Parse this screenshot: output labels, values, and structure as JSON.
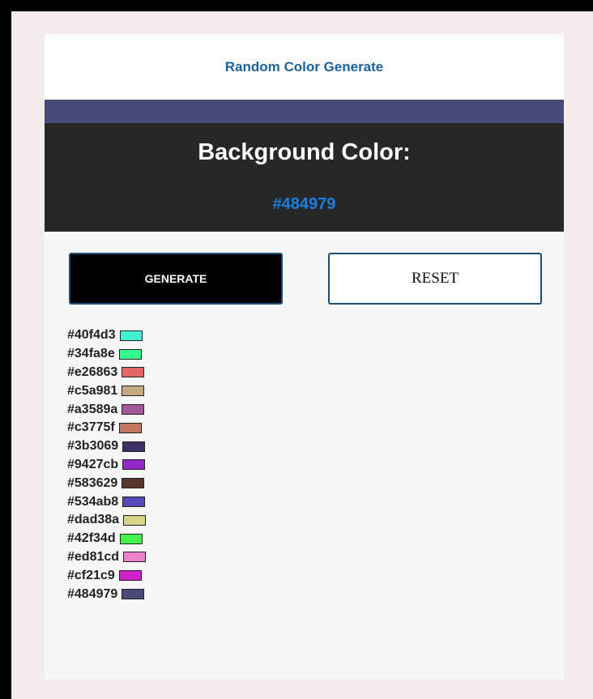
{
  "header": {
    "title": "Random Color Generate"
  },
  "display": {
    "label": "Background Color:",
    "current_color": "#484979"
  },
  "buttons": {
    "generate_label": "GENERATE",
    "reset_label": "RESET"
  },
  "history": [
    "#40f4d3",
    "#34fa8e",
    "#e26863",
    "#c5a981",
    "#a3589a",
    "#c3775f",
    "#3b3069",
    "#9427cb",
    "#583629",
    "#534ab8",
    "#dad38a",
    "#42f34d",
    "#ed81cd",
    "#cf21c9",
    "#484979"
  ],
  "colors": {
    "header_title": "#1a62a0",
    "display_background": "#272727",
    "display_value": "#1a7fe0",
    "page_background": "#f3ecea"
  }
}
